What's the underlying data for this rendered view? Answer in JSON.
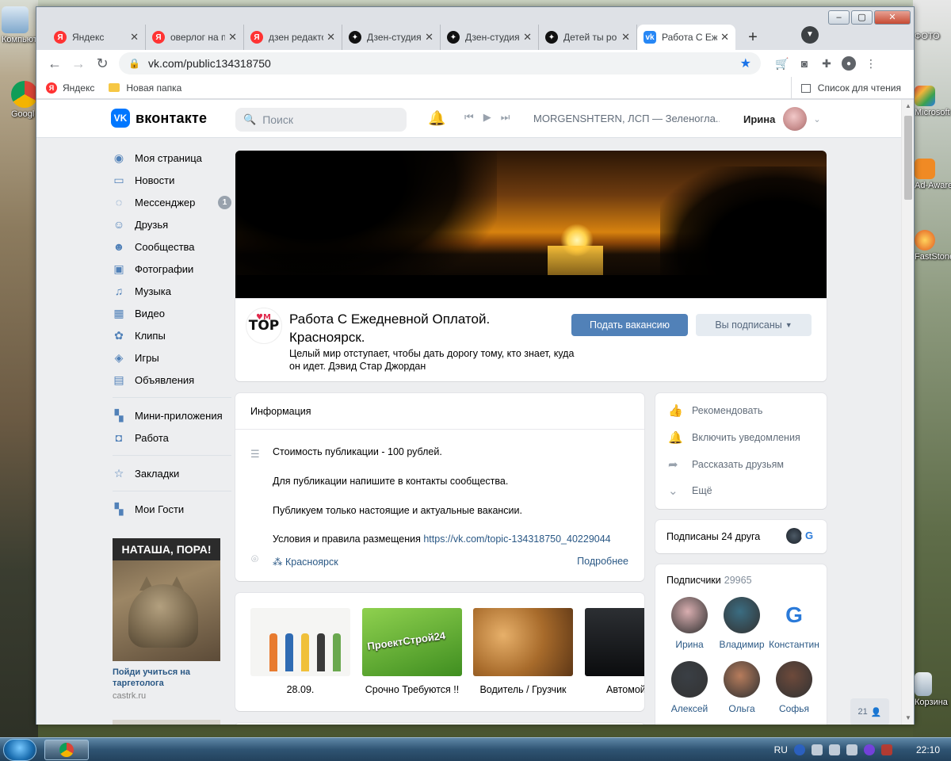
{
  "desktop": {
    "icons": [
      {
        "label": "Компьютер"
      },
      {
        "label": "Google Chrome"
      },
      {
        "label": "ФОТО"
      },
      {
        "label": "Microsoft Organizer"
      },
      {
        "label": "Ad-Aware Free"
      },
      {
        "label": "FastStone Image Viewer"
      },
      {
        "label": "Корзина"
      }
    ]
  },
  "taskbar": {
    "lang": "RU",
    "time": "22:10"
  },
  "browser": {
    "tabs": [
      {
        "title": "Яндекс",
        "favicon": "yandex-icon",
        "active": false
      },
      {
        "title": "оверлог на п",
        "favicon": "yandex-icon",
        "active": false
      },
      {
        "title": "дзен редакто",
        "favicon": "yandex-icon",
        "active": false
      },
      {
        "title": "Дзен-студия",
        "favicon": "zen-icon",
        "active": false
      },
      {
        "title": "Дзен-студия",
        "favicon": "zen-icon",
        "active": false
      },
      {
        "title": "Детей ты ро",
        "favicon": "zen-icon",
        "active": false
      },
      {
        "title": "Работа С Еж",
        "favicon": "vk-icon",
        "active": true
      }
    ],
    "new_tab": "+",
    "address": "vk.com/public134318750",
    "bookmarks": [
      {
        "label": "Яндекс",
        "type": "yandex"
      },
      {
        "label": "Новая папка",
        "type": "folder"
      }
    ],
    "reading_list": "Список для чтения"
  },
  "vk": {
    "logo_text": "вконтакте",
    "search_placeholder": "Поиск",
    "now_playing": "MORGENSHTERN, ЛСП — Зеленогла...",
    "user_name": "Ирина",
    "nav": [
      {
        "label": "Моя страница",
        "icon": "user-circle-icon",
        "symbol": "◉"
      },
      {
        "label": "Новости",
        "icon": "news-icon",
        "symbol": "▭"
      },
      {
        "label": "Мессенджер",
        "icon": "messenger-icon",
        "symbol": "◌",
        "badge": "1"
      },
      {
        "label": "Друзья",
        "icon": "friends-icon",
        "symbol": "☺"
      },
      {
        "label": "Сообщества",
        "icon": "communities-icon",
        "symbol": "☻"
      },
      {
        "label": "Фотографии",
        "icon": "photos-icon",
        "symbol": "▣"
      },
      {
        "label": "Музыка",
        "icon": "music-icon",
        "symbol": "♫"
      },
      {
        "label": "Видео",
        "icon": "video-icon",
        "symbol": "▦"
      },
      {
        "label": "Клипы",
        "icon": "clips-icon",
        "symbol": "✿"
      },
      {
        "label": "Игры",
        "icon": "games-icon",
        "symbol": "◈"
      },
      {
        "label": "Объявления",
        "icon": "classifieds-icon",
        "symbol": "▤"
      }
    ],
    "nav2": [
      {
        "label": "Мини-приложения",
        "icon": "apps-icon",
        "symbol": "▚"
      },
      {
        "label": "Работа",
        "icon": "work-icon",
        "symbol": "◘"
      }
    ],
    "nav3": [
      {
        "label": "Закладки",
        "icon": "bookmark-star-icon",
        "symbol": "☆"
      }
    ],
    "nav4": [
      {
        "label": "Мои Гости",
        "icon": "guests-icon",
        "symbol": "▚"
      }
    ],
    "ad": {
      "banner": "НАТАША, ПОРА!",
      "title": "Пойди учиться на таргетолога",
      "source": "castrk.ru"
    },
    "group": {
      "logo_text": "TOP",
      "title": "Работа С Ежедневной Оплатой. Красноярск.",
      "status": "Целый мир отступает, чтобы дать дорогу тому, кто знает, куда он идет. Дэвид Стар Джордан",
      "primary_button": "Подать вакансию",
      "secondary_button": "Вы подписаны"
    },
    "info": {
      "header": "Информация",
      "lines": [
        "Стоимость публикации - 100 рублей.",
        "Для публикации напишите в контакты сообщества.",
        "Публикуем только настоящие и актуальные вакансии."
      ],
      "rules_prefix": "Условия и правила размещения ",
      "rules_link": "https://vk.com/topic-134318750_40229044",
      "city": "Красноярск",
      "more": "Подробнее"
    },
    "gallery": [
      {
        "caption": "28.09."
      },
      {
        "caption": "Срочно Требуются !!",
        "pic_text": "ПроектСтрой24"
      },
      {
        "caption": "Водитель / Грузчик"
      },
      {
        "caption": "Автомой"
      }
    ],
    "actions": [
      {
        "label": "Рекомендовать",
        "icon": "thumb-up-icon",
        "symbol": "👍"
      },
      {
        "label": "Включить уведомления",
        "icon": "bell-icon",
        "symbol": "🔔"
      },
      {
        "label": "Рассказать друзьям",
        "icon": "share-icon",
        "symbol": "➦"
      },
      {
        "label": "Ещё",
        "icon": "chevron-down-icon",
        "symbol": "⌄"
      }
    ],
    "friends_subscribed": "Подписаны 24 друга",
    "subscribers": {
      "label": "Подписчики",
      "count": "29965",
      "people": [
        {
          "name": "Ирина",
          "color": "#d9aeb0"
        },
        {
          "name": "Владимир",
          "color": "#3b6d82"
        },
        {
          "name": "Константин",
          "color": "#ffffff"
        },
        {
          "name": "Алексей",
          "color": "#3a3f45"
        },
        {
          "name": "Ольга",
          "color": "#b77c5c"
        },
        {
          "name": "Софья",
          "color": "#6e4a3b"
        }
      ]
    },
    "online_counter": "21"
  }
}
